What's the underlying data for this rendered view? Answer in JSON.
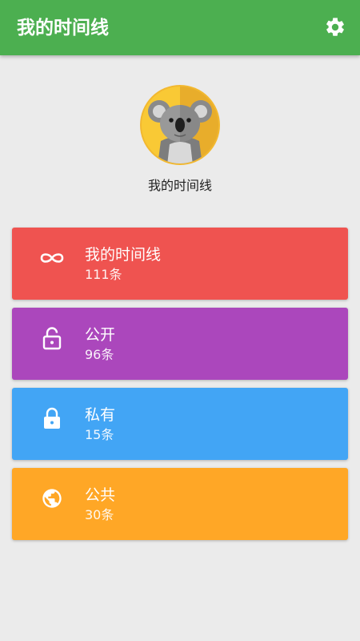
{
  "appbar": {
    "title": "我的时间线",
    "settings_icon": "gear-icon",
    "color": "#4caf50"
  },
  "profile": {
    "avatar": "koala-avatar",
    "name": "我的时间线"
  },
  "cards": [
    {
      "icon": "infinity-icon",
      "title": "我的时间线",
      "count": "111条",
      "color": "#ef5350"
    },
    {
      "icon": "unlock-icon",
      "title": "公开",
      "count": "96条",
      "color": "#ab47bc"
    },
    {
      "icon": "lock-icon",
      "title": "私有",
      "count": "15条",
      "color": "#42a5f5"
    },
    {
      "icon": "globe-icon",
      "title": "公共",
      "count": "30条",
      "color": "#ffa726"
    }
  ]
}
